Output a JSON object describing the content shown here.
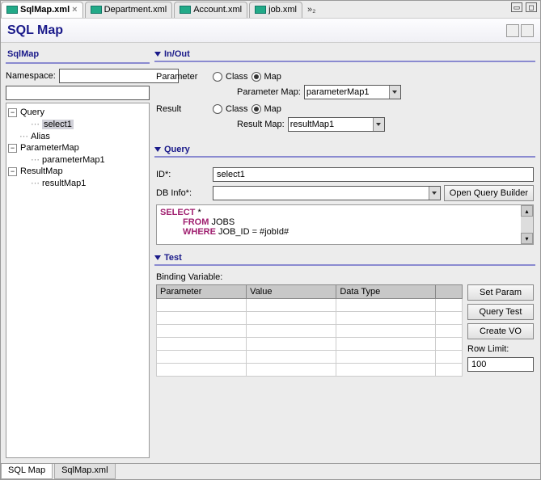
{
  "tabs": {
    "t0": "SqlMap.xml",
    "t1": "Department.xml",
    "t2": "Account.xml",
    "t3": "job.xml",
    "overflow": "»₂"
  },
  "title": "SQL Map",
  "left": {
    "header": "SqlMap",
    "namespace_label": "Namespace:",
    "tree": {
      "query": "Query",
      "select1": "select1",
      "alias": "Alias",
      "parammap": "ParameterMap",
      "parammap1": "parameterMap1",
      "resultmap": "ResultMap",
      "resultmap1": "resultMap1"
    }
  },
  "inout": {
    "header": "In/Out",
    "parameter_label": "Parameter",
    "class_label": "Class",
    "map_label": "Map",
    "param_map_label": "Parameter Map:",
    "param_map_value": "parameterMap1",
    "result_label": "Result",
    "result_map_label": "Result Map:",
    "result_map_value": "resultMap1"
  },
  "query": {
    "header": "Query",
    "id_label": "ID*:",
    "id_value": "select1",
    "dbinfo_label": "DB Info*:",
    "open_btn": "Open Query Builder",
    "sql_select": "SELECT",
    "sql_star": " *",
    "sql_from": "FROM",
    "sql_from_rest": " JOBS",
    "sql_where": "WHERE",
    "sql_where_rest": " JOB_ID = #jobId#"
  },
  "test": {
    "header": "Test",
    "binding_label": "Binding Variable:",
    "col_param": "Parameter",
    "col_value": "Value",
    "col_type": "Data Type",
    "set_param": "Set Param",
    "query_test": "Query Test",
    "create_vo": "Create VO",
    "row_limit_label": "Row Limit:",
    "row_limit_value": "100"
  },
  "bottom_tabs": {
    "t0": "SQL Map",
    "t1": "SqlMap.xml"
  }
}
